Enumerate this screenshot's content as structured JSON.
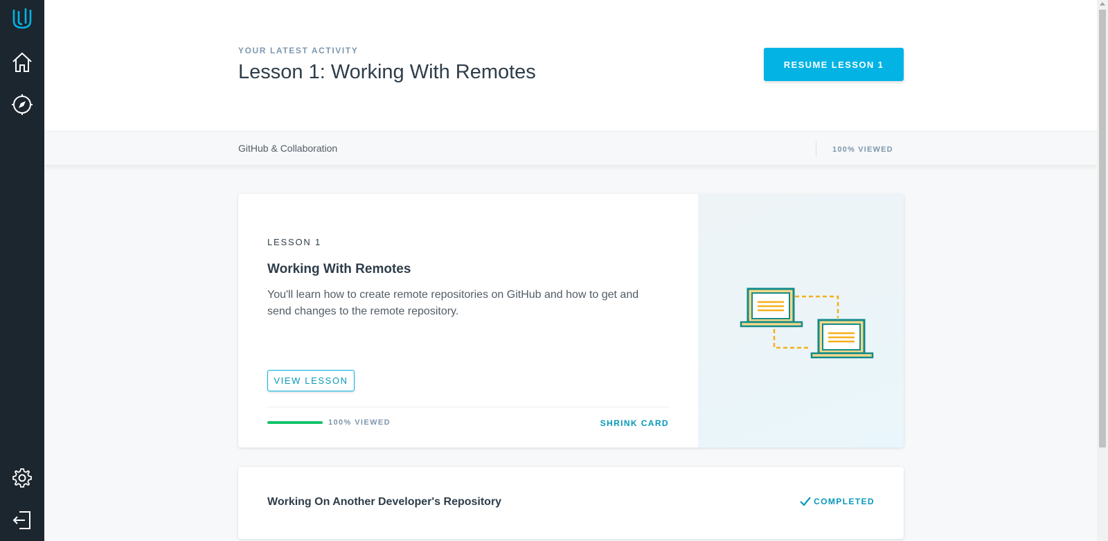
{
  "sidebar": {
    "icons": [
      "udacity-logo-icon",
      "home-icon",
      "compass-icon",
      "gear-icon",
      "logout-icon"
    ]
  },
  "header": {
    "eyebrow": "YOUR LATEST ACTIVITY",
    "title": "Lesson 1: Working With Remotes",
    "resume_label": "RESUME LESSON 1"
  },
  "subbar": {
    "course_name": "GitHub & Collaboration",
    "viewed": "100% VIEWED"
  },
  "lesson_card": {
    "label": "LESSON 1",
    "title": "Working With Remotes",
    "description": "You'll learn how to create remote repositories on GitHub and how to get and send changes to the remote repository.",
    "view_label": "VIEW LESSON",
    "progress_percent": 100,
    "viewed": "100% VIEWED",
    "shrink_label": "SHRINK CARD"
  },
  "next_card": {
    "title": "Working On Another Developer's Repository",
    "status": "COMPLETED"
  },
  "colors": {
    "sidebar": "#1c262f",
    "accent": "#02b3e4",
    "progress": "#15c26b",
    "illustration_teal": "#138a8a",
    "illustration_orange": "#f5b01a"
  }
}
